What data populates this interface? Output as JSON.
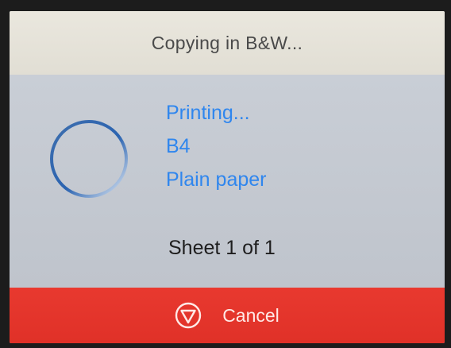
{
  "header": {
    "title": "Copying in B&W..."
  },
  "status": {
    "state": "Printing...",
    "paper_size": "B4",
    "paper_type": "Plain paper",
    "sheet_progress": "Sheet 1 of 1"
  },
  "icons": {
    "progress": "progress-ring-icon",
    "cancel": "stop-triangle-icon"
  },
  "cancel": {
    "label": "Cancel"
  },
  "colors": {
    "accent_blue": "#2f86ee",
    "cancel_red": "#e8392f",
    "header_bg": "#e7e4db",
    "body_bg": "#c5cad2"
  }
}
